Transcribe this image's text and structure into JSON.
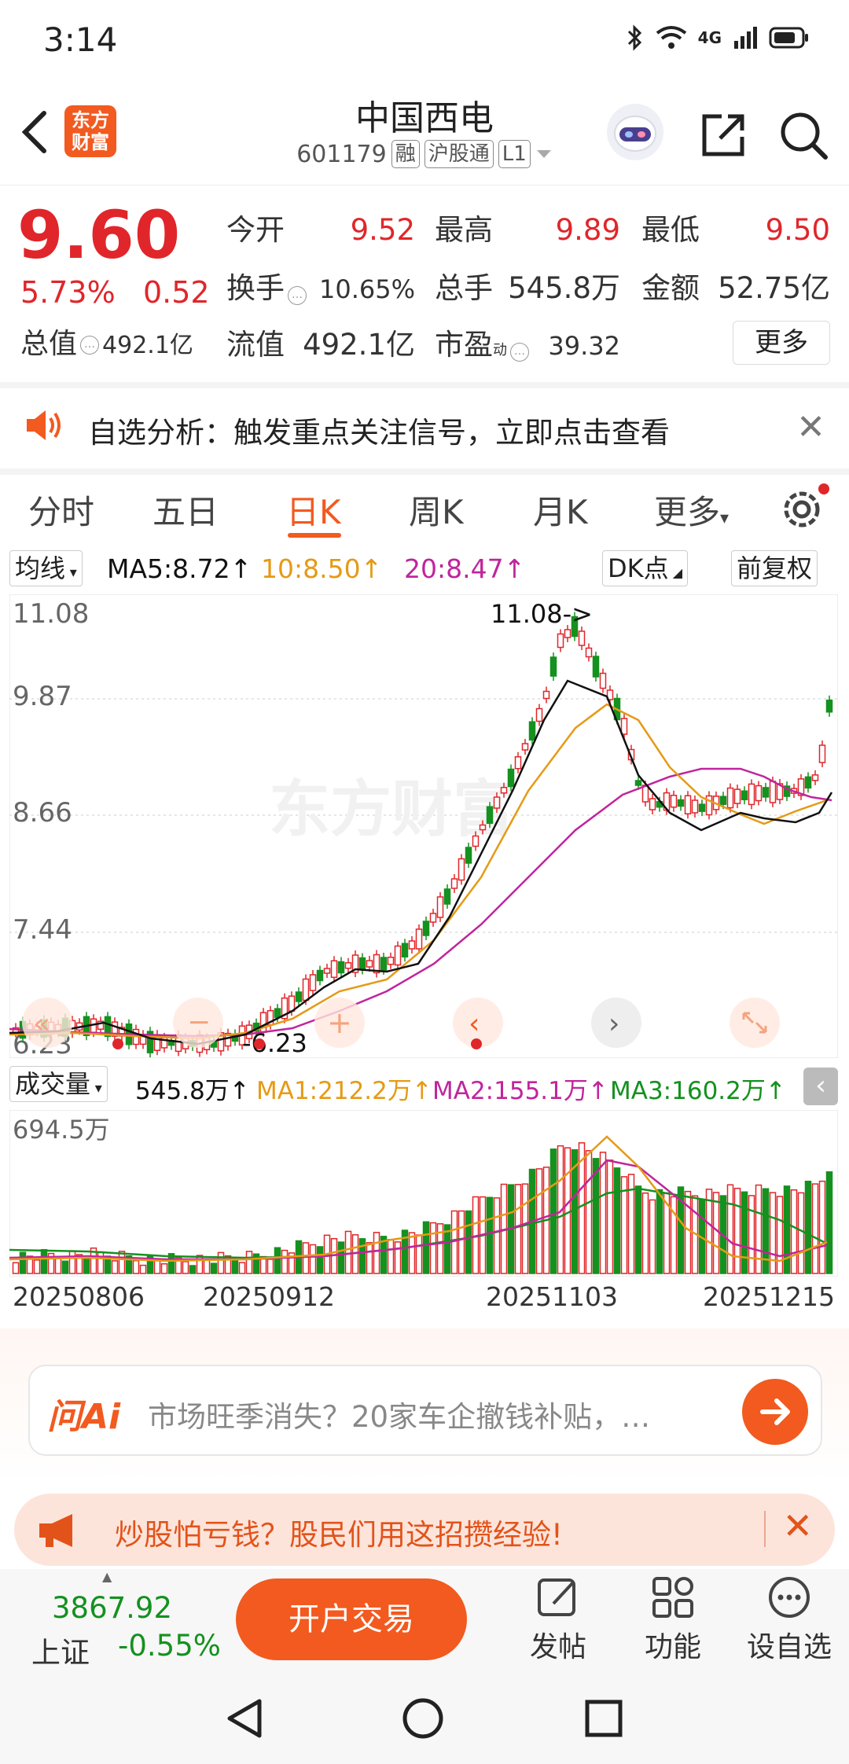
{
  "status_bar": {
    "time": "3:14",
    "network": "4G"
  },
  "header": {
    "logo_text_1": "东方",
    "logo_text_2": "财富",
    "stock_name": "中国西电",
    "stock_code": "601179",
    "tags": [
      "融",
      "沪股通",
      "L1"
    ]
  },
  "quote": {
    "price": "9.60",
    "change_pct": "5.73%",
    "change_amt": "0.52",
    "total_cap_label": "总值",
    "total_cap_value": "492.1亿",
    "cells": [
      {
        "label": "今开",
        "value": "9.52",
        "color": "#e0262a"
      },
      {
        "label": "最高",
        "value": "9.89",
        "color": "#e0262a"
      },
      {
        "label": "最低",
        "value": "9.50",
        "color": "#e0262a"
      },
      {
        "label": "换手",
        "value": "10.65%",
        "color": "#333"
      },
      {
        "label": "总手",
        "value": "545.8万",
        "color": "#333"
      },
      {
        "label": "金额",
        "value": "52.75亿",
        "color": "#333"
      },
      {
        "label": "流值",
        "value": "492.1亿",
        "color": "#333"
      },
      {
        "label": "市盈",
        "value": "39.32",
        "color": "#333"
      }
    ],
    "pe_superscript": "动",
    "more_label": "更多"
  },
  "alert": {
    "text": "自选分析：触发重点关注信号，立即点击查看"
  },
  "tabs": [
    "分时",
    "五日",
    "日K",
    "周K",
    "月K",
    "更多"
  ],
  "active_tab": "日K",
  "ma_row": {
    "selector": "均线",
    "ma5": "MA5:8.72↑",
    "ma10": "10:8.50↑",
    "ma20": "20:8.47↑",
    "dk_label": "DK点",
    "adjust_label": "前复权"
  },
  "kline": {
    "y_labels": [
      "11.08",
      "9.87",
      "8.66",
      "7.44",
      "6.23"
    ],
    "high_annotation": "11.08->",
    "low_annotation": "-6.23",
    "watermark": "东方财富"
  },
  "volume": {
    "selector": "成交量",
    "value": "545.8万↑",
    "ma1": "MA1:212.2万↑",
    "ma2": "MA2:155.1万↑",
    "ma3": "MA3:160.2万↑",
    "max_label": "694.5万"
  },
  "dates": [
    "20250806",
    "20250912",
    "20251103",
    "20251215"
  ],
  "ask_ai": {
    "logo": "问Ai",
    "text": "市场旺季消失？20家车企撤钱补贴，…"
  },
  "promo": {
    "text": "炒股怕亏钱？股民们用这招攒经验!"
  },
  "bottom_bar": {
    "index_value": "3867.92",
    "index_name": "上证",
    "index_change": "-0.55%",
    "trade_button": "开户交易",
    "items": [
      "发帖",
      "功能",
      "设自选"
    ]
  },
  "colors": {
    "accent": "#f25a1f",
    "up": "#e0262a",
    "down": "#14911f",
    "ma5": "#111111",
    "ma10": "#e59a16",
    "ma20": "#c0259c"
  },
  "chart_data": {
    "type": "candlestick",
    "ylim": [
      6.23,
      11.08
    ],
    "ma_lines": [
      "MA5",
      "MA10",
      "MA20"
    ],
    "x_ticks": [
      "20250806",
      "20250912",
      "20251103",
      "20251215"
    ]
  }
}
